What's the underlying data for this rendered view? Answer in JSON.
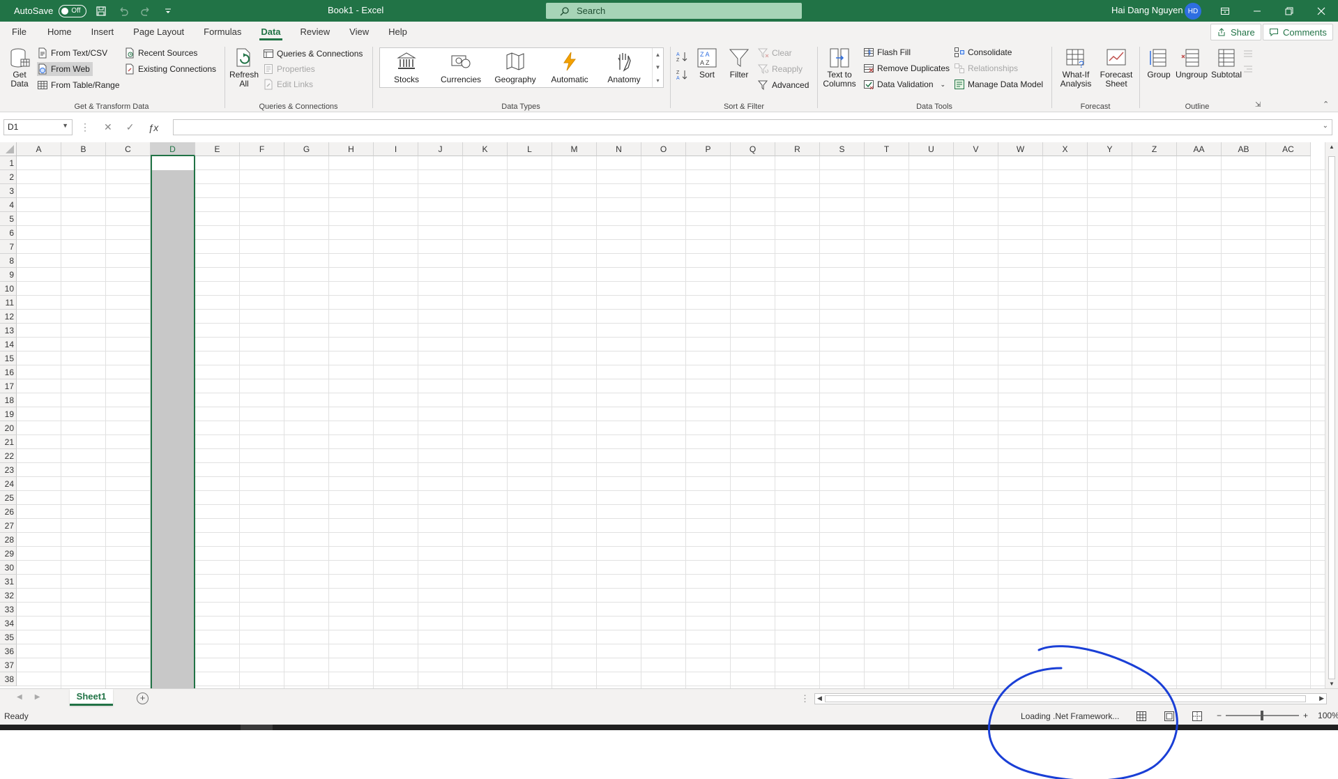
{
  "titlebar": {
    "autosave_label": "AutoSave",
    "autosave_state": "Off",
    "doc_title": "Book1  -  Excel",
    "search_placeholder": "Search",
    "user_name": "Hai Dang Nguyen",
    "user_initials": "HD"
  },
  "tabs": [
    "File",
    "Home",
    "Insert",
    "Page Layout",
    "Formulas",
    "Data",
    "Review",
    "View",
    "Help"
  ],
  "active_tab": "Data",
  "share_label": "Share",
  "comments_label": "Comments",
  "ribbon": {
    "get_transform": {
      "get_data": "Get Data",
      "from_text_csv": "From Text/CSV",
      "from_web": "From Web",
      "from_table_range": "From Table/Range",
      "recent_sources": "Recent Sources",
      "existing_connections": "Existing Connections",
      "label": "Get & Transform Data"
    },
    "queries": {
      "refresh_all": "Refresh All",
      "queries_connections": "Queries & Connections",
      "properties": "Properties",
      "edit_links": "Edit Links",
      "label": "Queries & Connections"
    },
    "data_types": {
      "items": [
        "Stocks",
        "Currencies",
        "Geography",
        "Automatic",
        "Anatomy"
      ],
      "label": "Data Types"
    },
    "sort_filter": {
      "sort": "Sort",
      "filter": "Filter",
      "clear": "Clear",
      "reapply": "Reapply",
      "advanced": "Advanced",
      "label": "Sort & Filter"
    },
    "data_tools": {
      "text_to_columns": "Text to Columns",
      "flash_fill": "Flash Fill",
      "remove_duplicates": "Remove Duplicates",
      "data_validation": "Data Validation",
      "consolidate": "Consolidate",
      "relationships": "Relationships",
      "manage_data_model": "Manage Data Model",
      "label": "Data Tools"
    },
    "forecast": {
      "what_if": "What-If Analysis",
      "forecast_sheet": "Forecast Sheet",
      "label": "Forecast"
    },
    "outline": {
      "group": "Group",
      "ungroup": "Ungroup",
      "subtotal": "Subtotal",
      "label": "Outline"
    }
  },
  "formula_bar": {
    "name_box": "D1",
    "formula": ""
  },
  "grid": {
    "columns": [
      "A",
      "B",
      "C",
      "D",
      "E",
      "F",
      "G",
      "H",
      "I",
      "J",
      "K",
      "L",
      "M",
      "N",
      "O",
      "P",
      "Q",
      "R",
      "S",
      "T",
      "U",
      "V",
      "W",
      "X",
      "Y",
      "Z",
      "AA",
      "AB",
      "AC"
    ],
    "selected_column": "D",
    "rows": [
      "1",
      "2",
      "3",
      "4",
      "5",
      "6",
      "7",
      "8",
      "9",
      "10",
      "11",
      "12",
      "13",
      "14",
      "15",
      "16",
      "17",
      "18",
      "19",
      "20",
      "21",
      "22",
      "23",
      "24",
      "25",
      "26",
      "27",
      "28",
      "29",
      "30",
      "31",
      "32",
      "33",
      "34",
      "35",
      "36",
      "37",
      "38"
    ]
  },
  "sheets": [
    "Sheet1"
  ],
  "status": {
    "ready": "Ready",
    "loading": "Loading .Net Framework...",
    "zoom": "100%"
  },
  "colors": {
    "excel_green": "#217346",
    "annotation_blue": "#1a3fd6"
  }
}
